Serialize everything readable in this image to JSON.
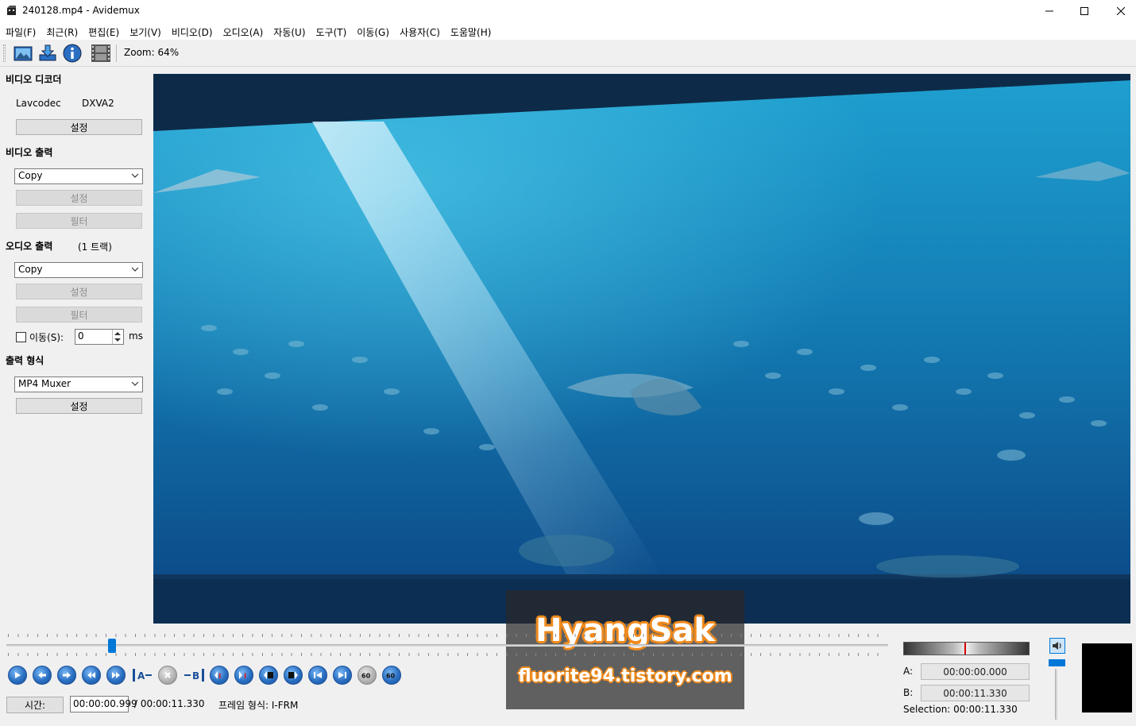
{
  "window": {
    "title": "240128.mp4 - Avidemux"
  },
  "menu": [
    "파일(F)",
    "최근(R)",
    "편집(E)",
    "보기(V)",
    "비디오(D)",
    "오디오(A)",
    "자동(U)",
    "도구(T)",
    "이동(G)",
    "사용자(C)",
    "도움말(H)"
  ],
  "toolbar": {
    "zoom_label": "Zoom: 64%"
  },
  "video_decoder": {
    "title": "비디오 디코더",
    "codec": "Lavcodec",
    "hw": "DXVA2",
    "settings_label": "설정"
  },
  "video_output": {
    "title": "비디오 출력",
    "selected": "Copy",
    "settings_label": "설정",
    "filter_label": "필터"
  },
  "audio_output": {
    "title": "오디오 출력",
    "tracks": "(1 트랙)",
    "selected": "Copy",
    "settings_label": "설정",
    "filter_label": "필터",
    "shift_label": "이동(S):",
    "shift_value": "0",
    "shift_unit": "ms"
  },
  "output_format": {
    "title": "출력 형식",
    "selected": "MP4 Muxer",
    "settings_label": "설정"
  },
  "playback": {
    "position_fraction": 0.12
  },
  "status": {
    "time_button": "시간:",
    "current_time": "00:00:00.999",
    "total_time": "/ 00:00:11.330",
    "frame_type": "프레임 형식: I-FRM"
  },
  "selection": {
    "a_label": "A:",
    "a_value": "00:00:00.000",
    "b_label": "B:",
    "b_value": "00:00:11.330",
    "selection_text": "Selection: 00:00:11.330"
  },
  "watermark": {
    "name": "HyangSak",
    "url": "fluorite94.tistory.com"
  },
  "colors": {
    "accent": "#0078d7",
    "water_light": "#1f8fc0",
    "water_dark": "#0a4a8a",
    "watermark_outline": "#f08a1c"
  }
}
